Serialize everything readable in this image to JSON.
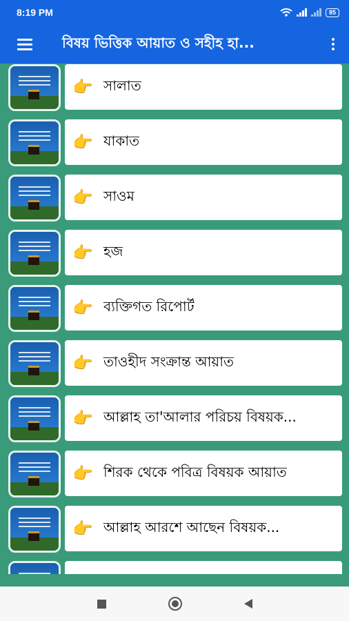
{
  "status_bar": {
    "time": "8:19 PM",
    "battery": "85"
  },
  "app_bar": {
    "title": "বিষয় ভিত্তিক আয়াত ও সহীহ হা..."
  },
  "list": {
    "items": [
      {
        "label": "সালাত"
      },
      {
        "label": "যাকাত"
      },
      {
        "label": "সাওম"
      },
      {
        "label": "হজ"
      },
      {
        "label": "ব্যক্তিগত রিপোর্ট"
      },
      {
        "label": "তাওহীদ সংক্রান্ত আয়াত"
      },
      {
        "label": "আল্লাহ তা'আলার পরিচয় বিষয়ক..."
      },
      {
        "label": "শিরক থেকে পবিত্র বিষয়ক আয়াত"
      },
      {
        "label": "আল্লাহ আরশে আছেন বিষয়ক..."
      },
      {
        "label": ""
      }
    ]
  },
  "colors": {
    "accent": "#1565e0",
    "background": "#3a9b7a",
    "card": "#ffffff",
    "hand": "#f0a21c"
  }
}
